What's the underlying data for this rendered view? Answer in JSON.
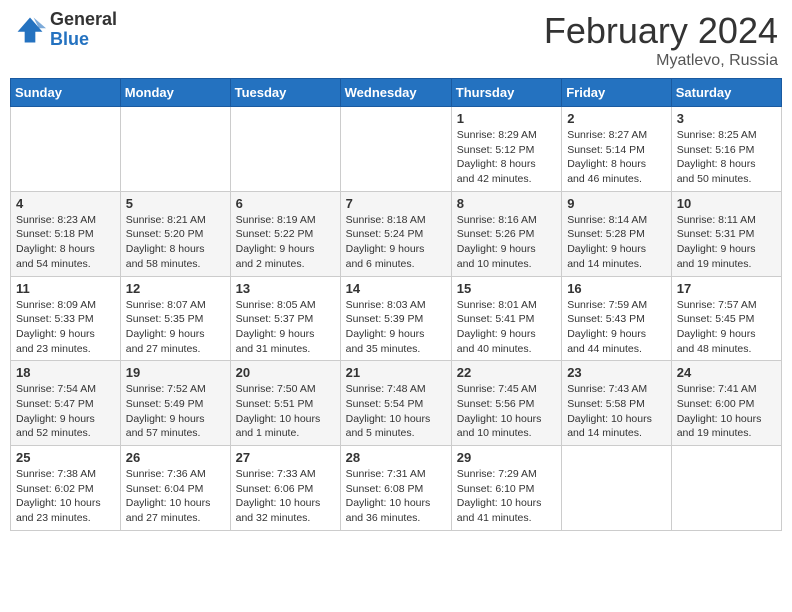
{
  "header": {
    "logo_general": "General",
    "logo_blue": "Blue",
    "month_title": "February 2024",
    "location": "Myatlevo, Russia"
  },
  "weekdays": [
    "Sunday",
    "Monday",
    "Tuesday",
    "Wednesday",
    "Thursday",
    "Friday",
    "Saturday"
  ],
  "weeks": [
    [
      {
        "day": "",
        "info": ""
      },
      {
        "day": "",
        "info": ""
      },
      {
        "day": "",
        "info": ""
      },
      {
        "day": "",
        "info": ""
      },
      {
        "day": "1",
        "info": "Sunrise: 8:29 AM\nSunset: 5:12 PM\nDaylight: 8 hours\nand 42 minutes."
      },
      {
        "day": "2",
        "info": "Sunrise: 8:27 AM\nSunset: 5:14 PM\nDaylight: 8 hours\nand 46 minutes."
      },
      {
        "day": "3",
        "info": "Sunrise: 8:25 AM\nSunset: 5:16 PM\nDaylight: 8 hours\nand 50 minutes."
      }
    ],
    [
      {
        "day": "4",
        "info": "Sunrise: 8:23 AM\nSunset: 5:18 PM\nDaylight: 8 hours\nand 54 minutes."
      },
      {
        "day": "5",
        "info": "Sunrise: 8:21 AM\nSunset: 5:20 PM\nDaylight: 8 hours\nand 58 minutes."
      },
      {
        "day": "6",
        "info": "Sunrise: 8:19 AM\nSunset: 5:22 PM\nDaylight: 9 hours\nand 2 minutes."
      },
      {
        "day": "7",
        "info": "Sunrise: 8:18 AM\nSunset: 5:24 PM\nDaylight: 9 hours\nand 6 minutes."
      },
      {
        "day": "8",
        "info": "Sunrise: 8:16 AM\nSunset: 5:26 PM\nDaylight: 9 hours\nand 10 minutes."
      },
      {
        "day": "9",
        "info": "Sunrise: 8:14 AM\nSunset: 5:28 PM\nDaylight: 9 hours\nand 14 minutes."
      },
      {
        "day": "10",
        "info": "Sunrise: 8:11 AM\nSunset: 5:31 PM\nDaylight: 9 hours\nand 19 minutes."
      }
    ],
    [
      {
        "day": "11",
        "info": "Sunrise: 8:09 AM\nSunset: 5:33 PM\nDaylight: 9 hours\nand 23 minutes."
      },
      {
        "day": "12",
        "info": "Sunrise: 8:07 AM\nSunset: 5:35 PM\nDaylight: 9 hours\nand 27 minutes."
      },
      {
        "day": "13",
        "info": "Sunrise: 8:05 AM\nSunset: 5:37 PM\nDaylight: 9 hours\nand 31 minutes."
      },
      {
        "day": "14",
        "info": "Sunrise: 8:03 AM\nSunset: 5:39 PM\nDaylight: 9 hours\nand 35 minutes."
      },
      {
        "day": "15",
        "info": "Sunrise: 8:01 AM\nSunset: 5:41 PM\nDaylight: 9 hours\nand 40 minutes."
      },
      {
        "day": "16",
        "info": "Sunrise: 7:59 AM\nSunset: 5:43 PM\nDaylight: 9 hours\nand 44 minutes."
      },
      {
        "day": "17",
        "info": "Sunrise: 7:57 AM\nSunset: 5:45 PM\nDaylight: 9 hours\nand 48 minutes."
      }
    ],
    [
      {
        "day": "18",
        "info": "Sunrise: 7:54 AM\nSunset: 5:47 PM\nDaylight: 9 hours\nand 52 minutes."
      },
      {
        "day": "19",
        "info": "Sunrise: 7:52 AM\nSunset: 5:49 PM\nDaylight: 9 hours\nand 57 minutes."
      },
      {
        "day": "20",
        "info": "Sunrise: 7:50 AM\nSunset: 5:51 PM\nDaylight: 10 hours\nand 1 minute."
      },
      {
        "day": "21",
        "info": "Sunrise: 7:48 AM\nSunset: 5:54 PM\nDaylight: 10 hours\nand 5 minutes."
      },
      {
        "day": "22",
        "info": "Sunrise: 7:45 AM\nSunset: 5:56 PM\nDaylight: 10 hours\nand 10 minutes."
      },
      {
        "day": "23",
        "info": "Sunrise: 7:43 AM\nSunset: 5:58 PM\nDaylight: 10 hours\nand 14 minutes."
      },
      {
        "day": "24",
        "info": "Sunrise: 7:41 AM\nSunset: 6:00 PM\nDaylight: 10 hours\nand 19 minutes."
      }
    ],
    [
      {
        "day": "25",
        "info": "Sunrise: 7:38 AM\nSunset: 6:02 PM\nDaylight: 10 hours\nand 23 minutes."
      },
      {
        "day": "26",
        "info": "Sunrise: 7:36 AM\nSunset: 6:04 PM\nDaylight: 10 hours\nand 27 minutes."
      },
      {
        "day": "27",
        "info": "Sunrise: 7:33 AM\nSunset: 6:06 PM\nDaylight: 10 hours\nand 32 minutes."
      },
      {
        "day": "28",
        "info": "Sunrise: 7:31 AM\nSunset: 6:08 PM\nDaylight: 10 hours\nand 36 minutes."
      },
      {
        "day": "29",
        "info": "Sunrise: 7:29 AM\nSunset: 6:10 PM\nDaylight: 10 hours\nand 41 minutes."
      },
      {
        "day": "",
        "info": ""
      },
      {
        "day": "",
        "info": ""
      }
    ]
  ]
}
